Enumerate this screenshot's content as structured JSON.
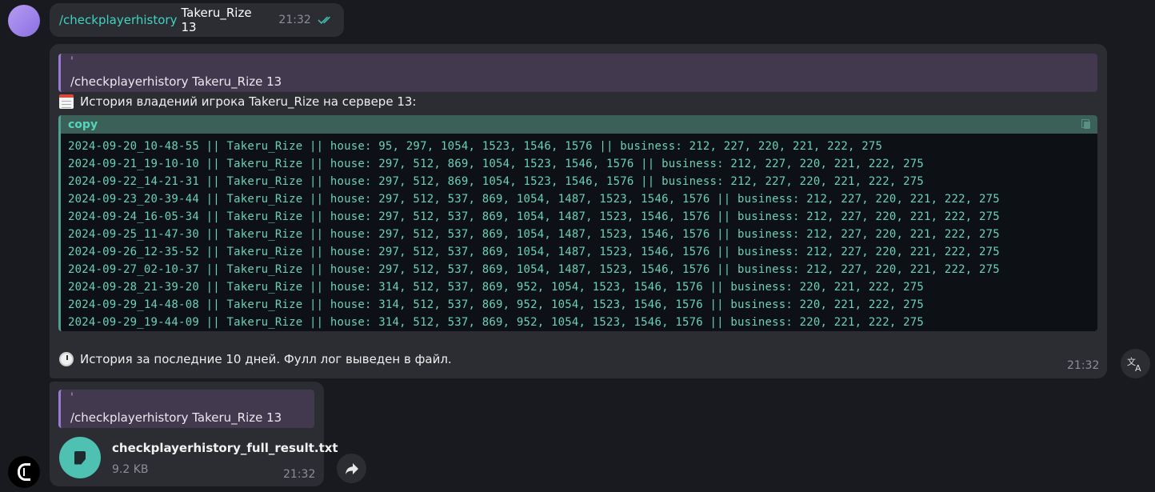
{
  "outgoing": {
    "command": "/checkplayerhistory",
    "args": "Takeru_Rize 13",
    "time": "21:32",
    "status_icon": "double-check-icon"
  },
  "result_message": {
    "reply_mark": "'",
    "reply_text": "/checkplayerhistory Takeru_Rize 13",
    "headline_icon": "calendar-icon",
    "headline": "История владений игрока Takeru_Rize на сервере 13:",
    "code_lang": "copy",
    "code_lines": [
      "2024-09-20_10-48-55 || Takeru_Rize || house: 95, 297, 1054, 1523, 1546, 1576 || business: 212, 227, 220, 221, 222, 275",
      "2024-09-21_19-10-10 || Takeru_Rize || house: 297, 512, 869, 1054, 1523, 1546, 1576 || business: 212, 227, 220, 221, 222, 275",
      "2024-09-22_14-21-31 || Takeru_Rize || house: 297, 512, 869, 1054, 1523, 1546, 1576 || business: 212, 227, 220, 221, 222, 275",
      "2024-09-23_20-39-44 || Takeru_Rize || house: 297, 512, 537, 869, 1054, 1487, 1523, 1546, 1576 || business: 212, 227, 220, 221, 222, 275",
      "2024-09-24_16-05-34 || Takeru_Rize || house: 297, 512, 537, 869, 1054, 1487, 1523, 1546, 1576 || business: 212, 227, 220, 221, 222, 275",
      "2024-09-25_11-47-30 || Takeru_Rize || house: 297, 512, 537, 869, 1054, 1487, 1523, 1546, 1576 || business: 212, 227, 220, 221, 222, 275",
      "2024-09-26_12-35-52 || Takeru_Rize || house: 297, 512, 537, 869, 1054, 1487, 1523, 1546, 1576 || business: 212, 227, 220, 221, 222, 275",
      "2024-09-27_02-10-37 || Takeru_Rize || house: 297, 512, 537, 869, 1054, 1487, 1523, 1546, 1576 || business: 212, 227, 220, 221, 222, 275",
      "2024-09-28_21-39-20 || Takeru_Rize || house: 314, 512, 537, 869, 952, 1054, 1523, 1546, 1576 || business: 220, 221, 222, 275",
      "2024-09-29_14-48-08 || Takeru_Rize || house: 314, 512, 537, 869, 952, 1054, 1523, 1546, 1576 || business: 220, 221, 222, 275",
      "2024-09-29_19-44-09 || Takeru_Rize || house: 314, 512, 537, 869, 952, 1054, 1523, 1546, 1576 || business: 220, 221, 222, 275"
    ],
    "footer_icon": "stopwatch-icon",
    "footer": "История за последние 10 дней. Фулл лог выведен в файл.",
    "time": "21:32"
  },
  "file_message": {
    "reply_mark": "'",
    "reply_text": "/checkplayerhistory Takeru_Rize 13",
    "file_name": "checkplayerhistory_full_result.txt",
    "file_size": "9.2 KB",
    "time": "21:32"
  },
  "colors": {
    "background": "#181a1f",
    "bubble": "#2b2d33",
    "accent_teal": "#3fd3c2",
    "code_text": "#69d1bb",
    "reply_bar": "#9a7ad6"
  }
}
